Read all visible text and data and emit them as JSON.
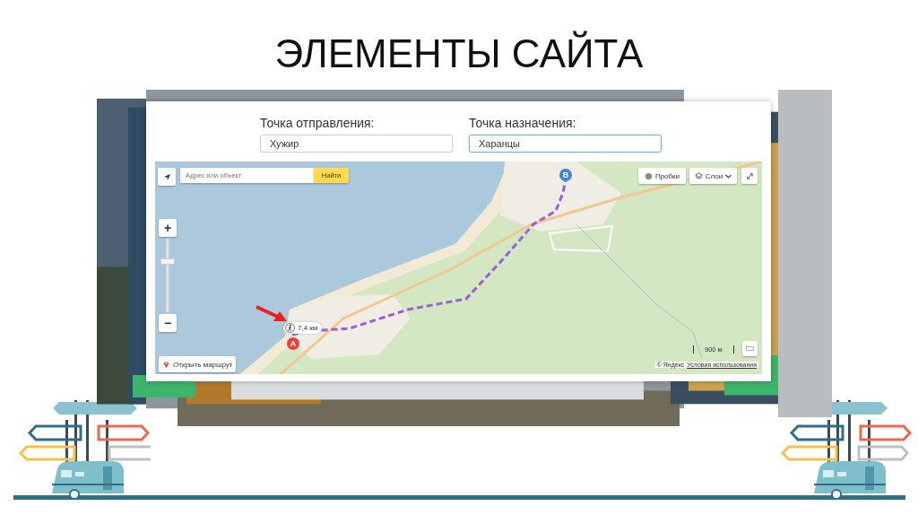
{
  "slide": {
    "title": "ЭЛЕМЕНТЫ САЙТА"
  },
  "route_form": {
    "fields": [
      {
        "label": "Точка отправления:",
        "value": "Хужир",
        "focused": false
      },
      {
        "label": "Точка назначения:",
        "value": "Харанцы",
        "focused": true
      }
    ]
  },
  "map": {
    "search": {
      "placeholder": "Адрес или объект",
      "button": "Найти"
    },
    "zoom": {
      "in": "+",
      "out": "−",
      "level": 0.69
    },
    "traffic_button": "Пробки",
    "layers_button": "Слои",
    "route_distance": "7,4 км",
    "markers": [
      {
        "letter": "A",
        "color": "#e8413a"
      },
      {
        "letter": "B",
        "color": "#3d86d8"
      }
    ],
    "open_route": "Открыть маршрут",
    "scale": "900 м",
    "copyright": "© Яндекс",
    "terms_link": "Условия использования"
  }
}
